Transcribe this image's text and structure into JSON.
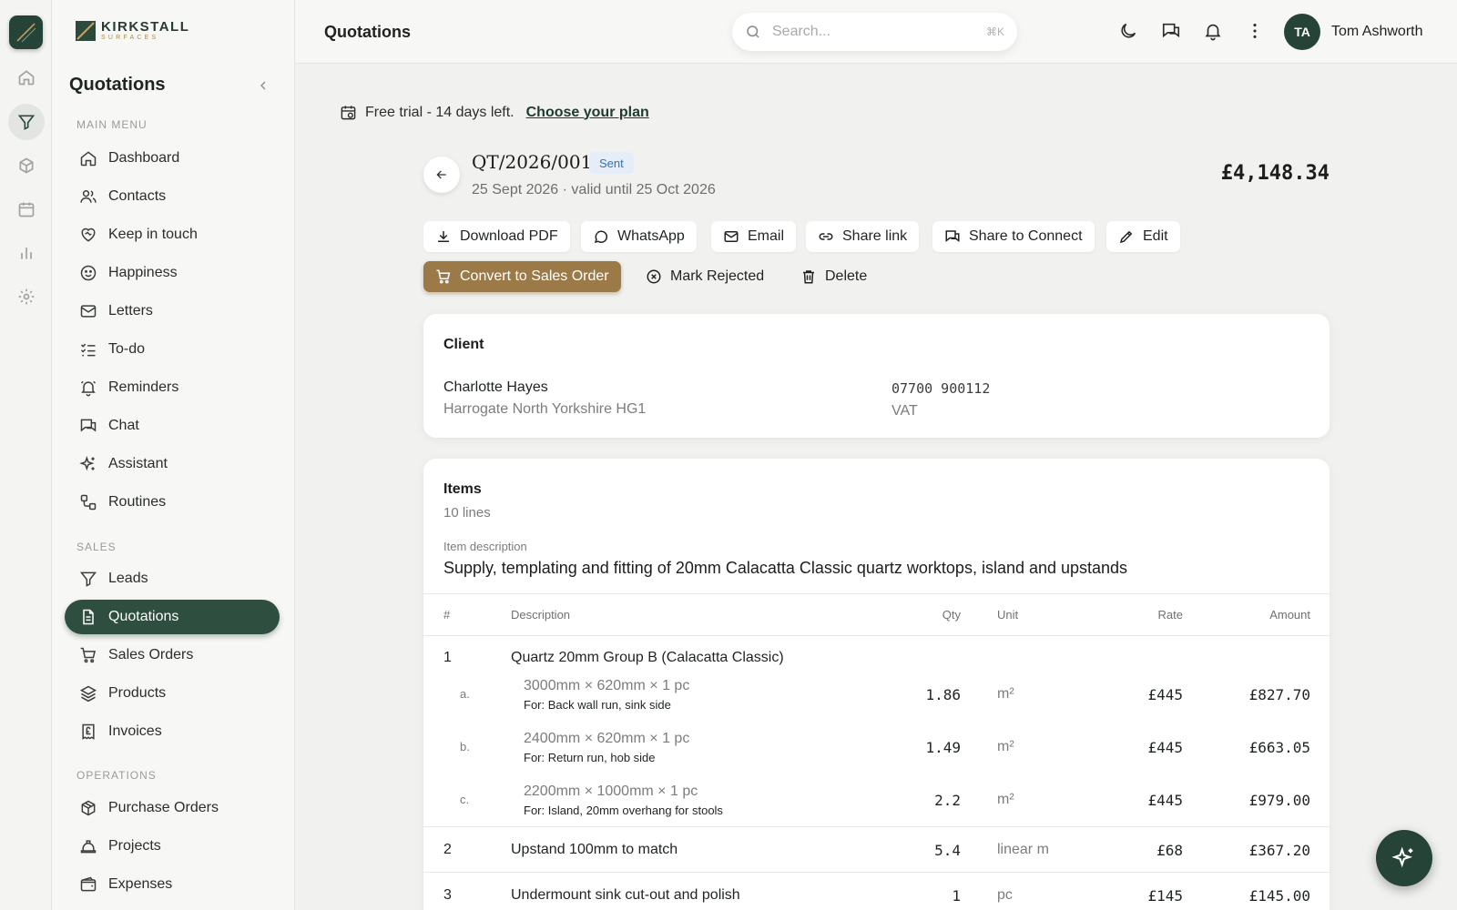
{
  "brand": {
    "name": "KIRKSTALL",
    "sub": "SURFACES"
  },
  "sidebar": {
    "title": "Quotations",
    "sections": [
      {
        "label": "MAIN MENU",
        "items": [
          "Dashboard",
          "Contacts",
          "Keep in touch",
          "Happiness",
          "Letters",
          "To-do",
          "Reminders",
          "Chat",
          "Assistant",
          "Routines"
        ]
      },
      {
        "label": "SALES",
        "items": [
          "Leads",
          "Quotations",
          "Sales Orders",
          "Products",
          "Invoices"
        ]
      },
      {
        "label": "OPERATIONS",
        "items": [
          "Purchase Orders",
          "Projects",
          "Expenses"
        ]
      }
    ],
    "active_item": "Quotations"
  },
  "header": {
    "title": "Quotations",
    "search_placeholder": "Search...",
    "search_shortcut": "⌘K",
    "user_initials": "TA",
    "user_name": "Tom Ashworth"
  },
  "trial": {
    "text": "Free trial - 14 days left.",
    "link": "Choose your plan"
  },
  "quote": {
    "number": "QT/2026/001",
    "status": "Sent",
    "meta": "25 Sept 2026 · valid until 25 Oct 2026",
    "total": "£4,148.34"
  },
  "actions": {
    "download_pdf": "Download PDF",
    "whatsapp": "WhatsApp",
    "email": "Email",
    "share_link": "Share link",
    "share_connect": "Share to Connect",
    "edit": "Edit",
    "convert": "Convert to Sales Order",
    "mark_rejected": "Mark Rejected",
    "delete": "Delete"
  },
  "client": {
    "heading": "Client",
    "name": "Charlotte Hayes",
    "address": "Harrogate North Yorkshire HG1",
    "phone": "07700 900112",
    "vat": "VAT"
  },
  "items": {
    "heading": "Items",
    "count": "10 lines",
    "desc_label": "Item description",
    "description": "Supply, templating and fitting of 20mm Calacatta Classic quartz worktops, island and upstands",
    "columns": {
      "num": "#",
      "description": "Description",
      "qty": "Qty",
      "unit": "Unit",
      "rate": "Rate",
      "amount": "Amount"
    },
    "rows": [
      {
        "num": "1",
        "description": "Quartz 20mm Group B (Calacatta Classic)"
      },
      {
        "letter": "a.",
        "size": "3000mm × 620mm × 1 pc",
        "note": "For: Back wall run, sink side",
        "qty": "1.86",
        "unit": "m²",
        "rate": "£445",
        "amount": "£827.70"
      },
      {
        "letter": "b.",
        "size": "2400mm × 620mm × 1 pc",
        "note": "For: Return run, hob side",
        "qty": "1.49",
        "unit": "m²",
        "rate": "£445",
        "amount": "£663.05"
      },
      {
        "letter": "c.",
        "size": "2200mm × 1000mm × 1 pc",
        "note": "For: Island, 20mm overhang for stools",
        "qty": "2.2",
        "unit": "m²",
        "rate": "£445",
        "amount": "£979.00"
      },
      {
        "num": "2",
        "description": "Upstand 100mm to match",
        "qty": "5.4",
        "unit": "linear m",
        "rate": "£68",
        "amount": "£367.20"
      },
      {
        "num": "3",
        "description": "Undermount sink cut-out and polish",
        "qty": "1",
        "unit": "pc",
        "rate": "£145",
        "amount": "£145.00"
      }
    ]
  }
}
